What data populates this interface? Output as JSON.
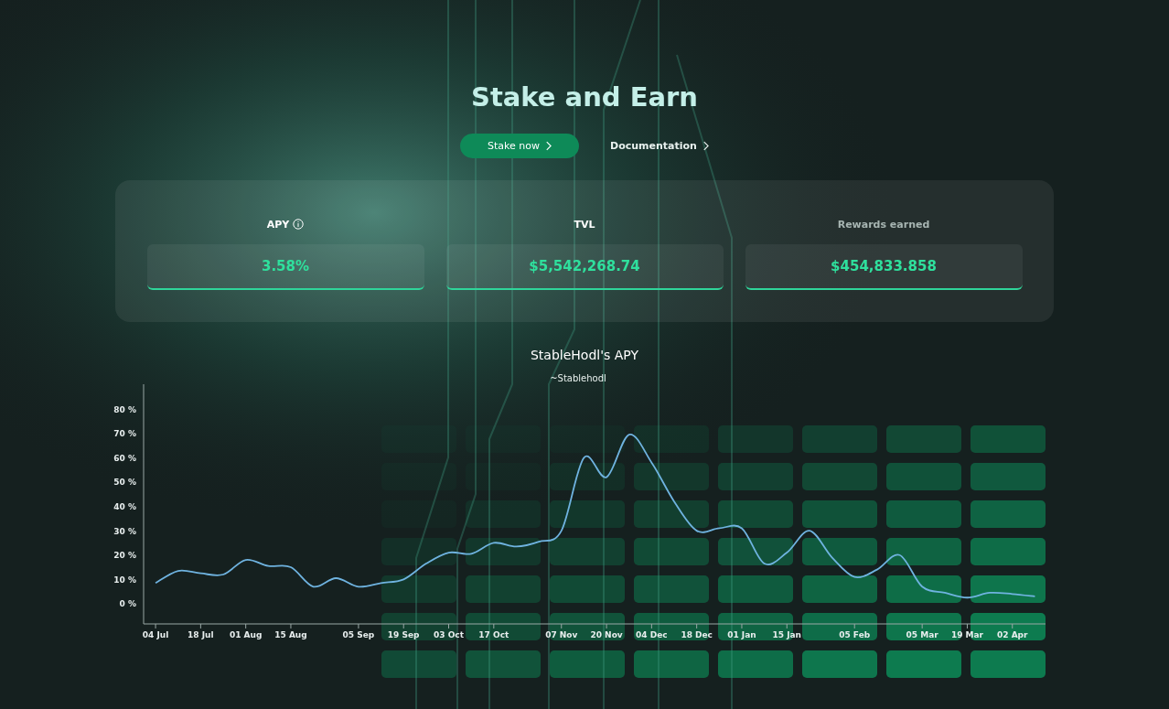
{
  "hero": {
    "title": "Stake and Earn",
    "primary_button": "Stake now",
    "secondary_link": "Documentation"
  },
  "stats": [
    {
      "label": "APY",
      "info": true,
      "muted": false,
      "value": "3.58%"
    },
    {
      "label": "TVL",
      "info": false,
      "muted": false,
      "value": "$5,542,268.74"
    },
    {
      "label": "Rewards earned",
      "info": false,
      "muted": true,
      "value": "$454,833.858"
    }
  ],
  "chart": {
    "title": "StableHodl's APY",
    "chart_data": {
      "type": "line",
      "categories": [
        "04 Jul",
        null,
        "18 Jul",
        null,
        "01 Aug",
        null,
        "15 Aug",
        null,
        null,
        "05 Sep",
        null,
        "19 Sep",
        null,
        "03 Oct",
        null,
        "17 Oct",
        null,
        null,
        "07 Nov",
        null,
        "20 Nov",
        null,
        "04 Dec",
        null,
        "18 Dec",
        null,
        "01 Jan",
        null,
        "15 Jan",
        null,
        null,
        "05 Feb",
        null,
        null,
        "05 Mar",
        null,
        "19 Mar",
        null,
        "02 Apr",
        null
      ],
      "series": [
        {
          "name": "~Stablehodl",
          "color": "#6fb3e0",
          "values": [
            8.5,
            13.5,
            12.5,
            12,
            18,
            15.5,
            15,
            7,
            10.5,
            7,
            8.5,
            10,
            16.5,
            21,
            20.5,
            25,
            23.5,
            25.5,
            30,
            60,
            52,
            69.5,
            58,
            42,
            30,
            31,
            31,
            16.5,
            21,
            30,
            19,
            11,
            14,
            20,
            7,
            4.5,
            2.5,
            4.5,
            4,
            3
          ]
        }
      ],
      "ylim": [
        -8.3,
        90.2
      ],
      "yticks": [
        {
          "value": 0,
          "label": "0 %"
        },
        {
          "value": 10,
          "label": "10 %"
        },
        {
          "value": 20,
          "label": "20 %"
        },
        {
          "value": 30,
          "label": "30 %"
        },
        {
          "value": 40,
          "label": "40 %"
        },
        {
          "value": 50,
          "label": "50 %"
        },
        {
          "value": 60,
          "label": "60 %"
        },
        {
          "value": 70,
          "label": "70 %"
        },
        {
          "value": 80,
          "label": "80 %"
        }
      ]
    }
  }
}
